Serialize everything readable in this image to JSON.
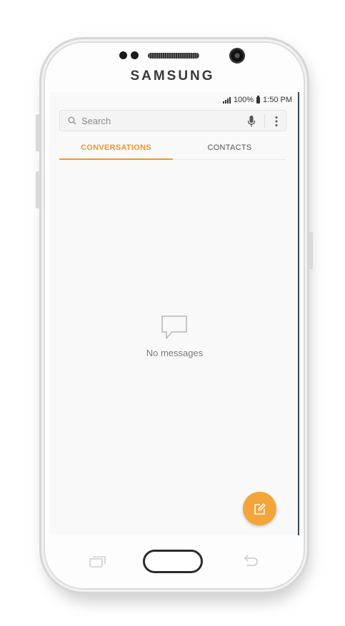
{
  "device": {
    "brand": "SAMSUNG"
  },
  "statusbar": {
    "battery": "100%",
    "time": "1:50 PM"
  },
  "search": {
    "placeholder": "Search"
  },
  "tabs": [
    {
      "label": "CONVERSATIONS",
      "active": true
    },
    {
      "label": "CONTACTS",
      "active": false
    }
  ],
  "empty_state": {
    "message": "No messages",
    "icon": "message-bubble-icon"
  },
  "fab": {
    "icon": "compose-icon"
  },
  "colors": {
    "accent": "#f0962a",
    "fab": "#f3a53a",
    "screen_bg": "#f9f9f9"
  }
}
